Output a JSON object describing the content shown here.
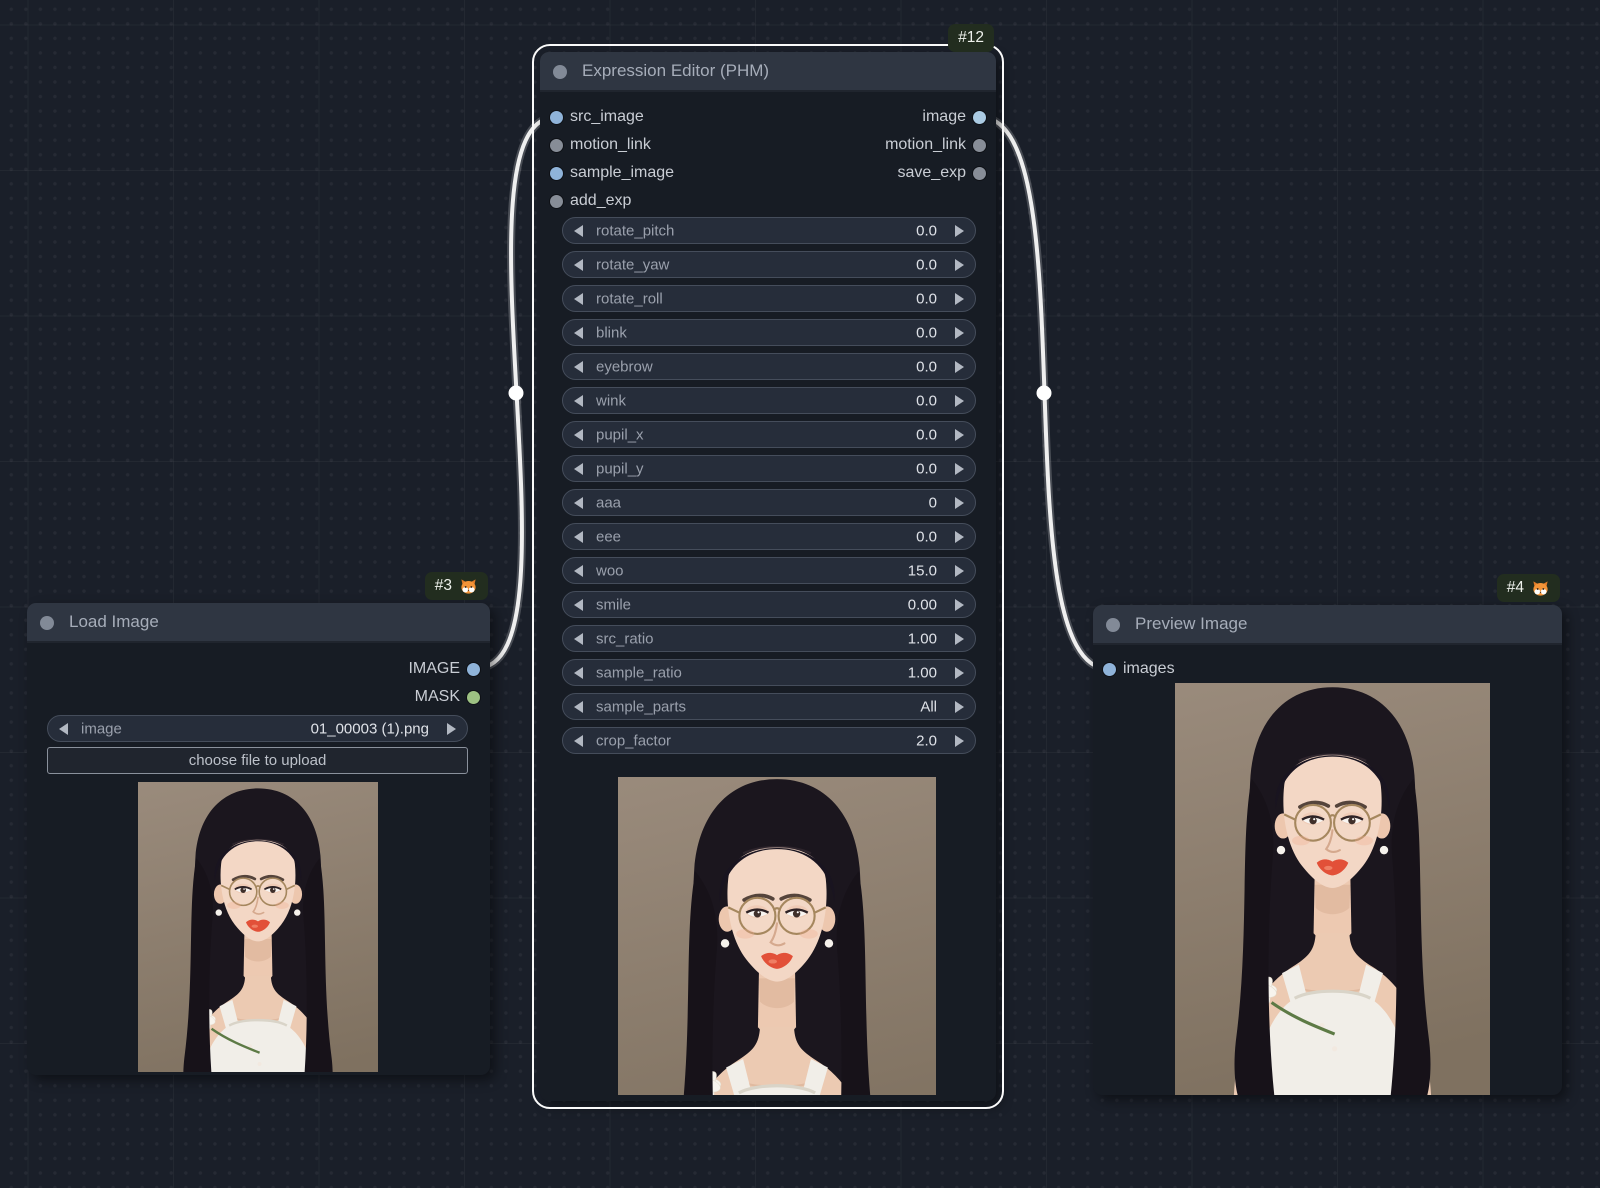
{
  "colors": {
    "canvas_bg": "#1a1f29",
    "node_bg": "#171c24",
    "node_header_bg": "#2f3642",
    "node_title": "#a6adb9",
    "title_dot": "#828a97",
    "io_label": "#c9cdd4",
    "widget_bg": "#262d3a",
    "widget_border": "#454d5b",
    "widget_label": "#9aa0ac",
    "widget_value": "#dfe2e8",
    "arrow": "#b2b8c2",
    "button_border": "#8a919c",
    "button_text": "#bcc1c9",
    "badge_bg": "#222d1f",
    "badge_text": "#eef1ec",
    "port_blue": "#8fb3d9",
    "port_blue_light": "#abcbe3",
    "port_gray": "#878d97",
    "port_green": "#9dc183",
    "wire": "#efefef",
    "selection": "#fafafa",
    "fox_orange": "#f39438"
  },
  "nodes": {
    "load_image": {
      "badge": "#3",
      "badge_icon": "fox-icon",
      "title": "Load Image",
      "outputs": [
        {
          "label": "IMAGE",
          "color": "blue"
        },
        {
          "label": "MASK",
          "color": "green"
        }
      ],
      "widgets": {
        "image_combo": {
          "label": "image",
          "value": "01_00003 (1).png"
        },
        "upload_button_label": "choose file to upload"
      },
      "preview_alt": "portrait photo: woman with round glasses, pearl earrings, white tank top, white flower on shoulder"
    },
    "expression_editor": {
      "badge": "#12",
      "title": "Expression Editor (PHM)",
      "selected": true,
      "inputs": [
        {
          "label": "src_image",
          "color": "blue"
        },
        {
          "label": "motion_link",
          "color": "gray"
        },
        {
          "label": "sample_image",
          "color": "blue"
        },
        {
          "label": "add_exp",
          "color": "gray"
        }
      ],
      "outputs": [
        {
          "label": "image",
          "color": "blue_light"
        },
        {
          "label": "motion_link",
          "color": "gray"
        },
        {
          "label": "save_exp",
          "color": "gray"
        }
      ],
      "sliders": [
        {
          "label": "rotate_pitch",
          "value": "0.0"
        },
        {
          "label": "rotate_yaw",
          "value": "0.0"
        },
        {
          "label": "rotate_roll",
          "value": "0.0"
        },
        {
          "label": "blink",
          "value": "0.0"
        },
        {
          "label": "eyebrow",
          "value": "0.0"
        },
        {
          "label": "wink",
          "value": "0.0"
        },
        {
          "label": "pupil_x",
          "value": "0.0"
        },
        {
          "label": "pupil_y",
          "value": "0.0"
        },
        {
          "label": "aaa",
          "value": "0"
        },
        {
          "label": "eee",
          "value": "0.0"
        },
        {
          "label": "woo",
          "value": "15.0"
        },
        {
          "label": "smile",
          "value": "0.00"
        },
        {
          "label": "src_ratio",
          "value": "1.00"
        },
        {
          "label": "sample_ratio",
          "value": "1.00"
        },
        {
          "label": "sample_parts",
          "value": "All"
        },
        {
          "label": "crop_factor",
          "value": "2.0"
        }
      ],
      "preview_alt": "cropped preview of same woman portrait"
    },
    "preview_image": {
      "badge": "#4",
      "badge_icon": "fox-icon",
      "title": "Preview Image",
      "inputs": [
        {
          "label": "images",
          "color": "blue"
        }
      ],
      "preview_alt": "resulting image of same woman portrait"
    }
  }
}
